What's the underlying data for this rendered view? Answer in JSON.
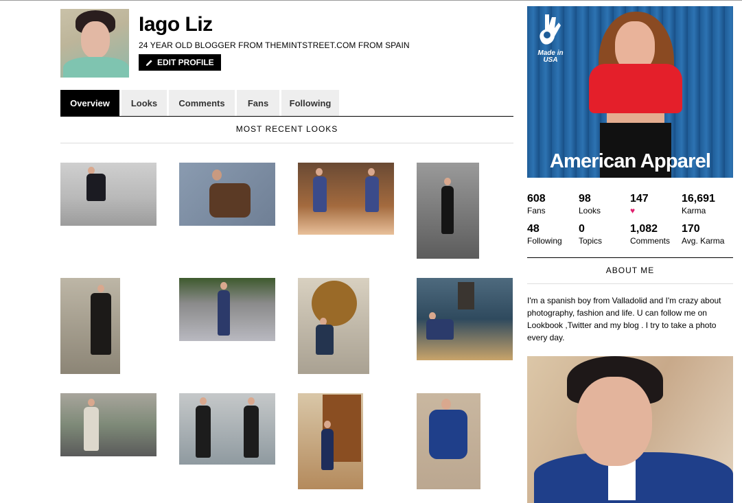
{
  "profile": {
    "name": "Iago Liz",
    "tagline": "24 YEAR OLD BLOGGER FROM THEMINTSTREET.COM FROM SPAIN",
    "edit_label": "EDIT PROFILE"
  },
  "tabs": [
    {
      "label": "Overview",
      "active": true
    },
    {
      "label": "Looks",
      "active": false
    },
    {
      "label": "Comments",
      "active": false
    },
    {
      "label": "Fans",
      "active": false
    },
    {
      "label": "Following",
      "active": false
    }
  ],
  "section_title": "MOST RECENT LOOKS",
  "ad": {
    "brand": "American Apparel",
    "badge": "Made in USA"
  },
  "stats": [
    {
      "num": "608",
      "label": "Fans"
    },
    {
      "num": "98",
      "label": "Looks"
    },
    {
      "num": "147",
      "label": "",
      "icon": "heart-icon"
    },
    {
      "num": "16,691",
      "label": "Karma"
    },
    {
      "num": "48",
      "label": "Following"
    },
    {
      "num": "0",
      "label": "Topics"
    },
    {
      "num": "1,082",
      "label": "Comments"
    },
    {
      "num": "170",
      "label": "Avg. Karma"
    }
  ],
  "about": {
    "title": "ABOUT ME",
    "text": "I'm a spanish boy from Valladolid and I'm crazy about photography, fashion and life. U can follow me on Lookbook ,Twitter and my blog . I try to take a photo every day."
  },
  "colors": {
    "accent": "#000000",
    "heart": "#e0226f",
    "ad_blue": "#1f5d98",
    "ad_red": "#e41f2a"
  }
}
